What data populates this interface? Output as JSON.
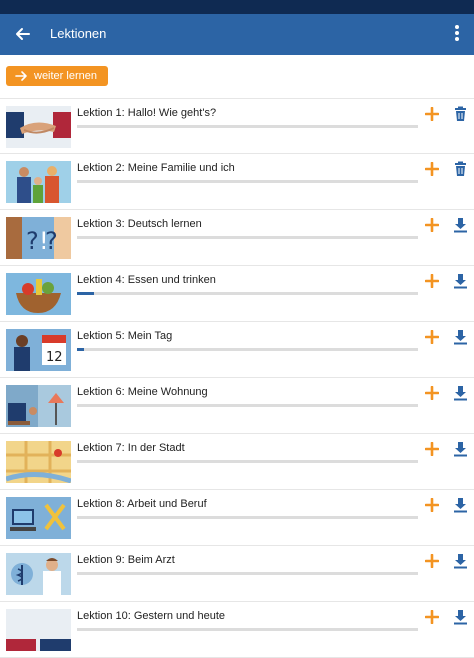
{
  "app_bar": {
    "title": "Lektionen",
    "back_icon": "arrow-left-icon",
    "menu_icon": "more-vert-icon"
  },
  "continue_button": {
    "label": "weiter lernen",
    "icon": "arrow-right-icon",
    "color": "#f39422"
  },
  "colors": {
    "primary": "#2c64a5",
    "accent": "#f39422",
    "status_bar": "#0f2a52"
  },
  "lessons": [
    {
      "title": "Lektion 1: Hallo! Wie geht's?",
      "progress": 0,
      "action": "trash-icon",
      "thumb": "handshake"
    },
    {
      "title": "Lektion 2: Meine Familie und ich",
      "progress": 0,
      "action": "trash-icon",
      "thumb": "family"
    },
    {
      "title": "Lektion 3: Deutsch lernen",
      "progress": 0,
      "action": "download-icon",
      "thumb": "question"
    },
    {
      "title": "Lektion 4: Essen und trinken",
      "progress": 0.05,
      "action": "download-icon",
      "thumb": "food"
    },
    {
      "title": "Lektion 5: Mein Tag",
      "progress": 0.02,
      "action": "download-icon",
      "thumb": "calendar"
    },
    {
      "title": "Lektion 6: Meine Wohnung",
      "progress": 0,
      "action": "download-icon",
      "thumb": "room"
    },
    {
      "title": "Lektion 7: In der Stadt",
      "progress": 0,
      "action": "download-icon",
      "thumb": "map"
    },
    {
      "title": "Lektion 8: Arbeit und Beruf",
      "progress": 0,
      "action": "download-icon",
      "thumb": "work"
    },
    {
      "title": "Lektion 9: Beim Arzt",
      "progress": 0,
      "action": "download-icon",
      "thumb": "doctor"
    },
    {
      "title": "Lektion 10: Gestern und heute",
      "progress": 0,
      "action": "download-icon",
      "thumb": "history"
    }
  ]
}
